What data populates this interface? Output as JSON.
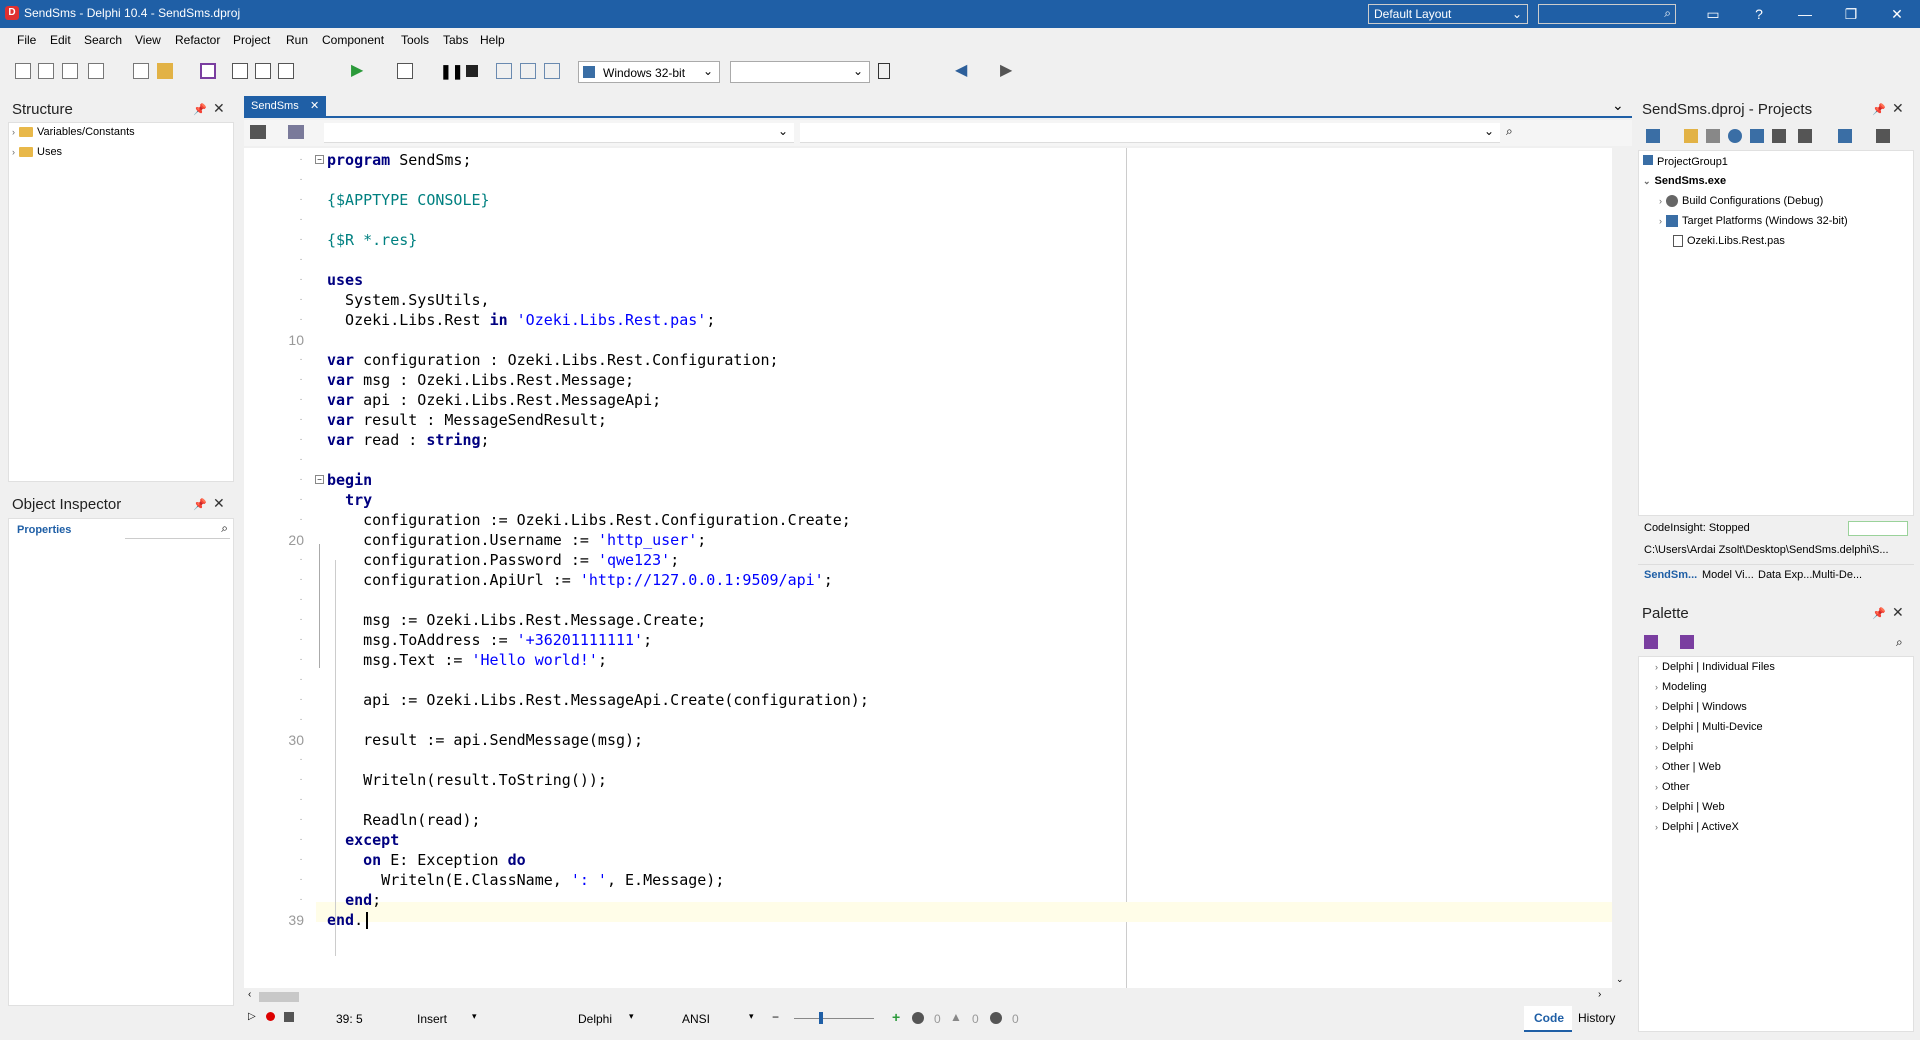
{
  "window": {
    "title": "SendSms - Delphi 10.4 - SendSms.dproj",
    "layout": "Default Layout",
    "search_placeholder": ""
  },
  "menu": [
    "File",
    "Edit",
    "Search",
    "View",
    "Refactor",
    "Project",
    "Run",
    "Component",
    "Tools",
    "Tabs",
    "Help"
  ],
  "toolbar": {
    "platform": "Windows 32-bit",
    "config": ""
  },
  "structure": {
    "title": "Structure",
    "items": [
      "Variables/Constants",
      "Uses"
    ]
  },
  "inspector": {
    "title": "Object Inspector",
    "tab": "Properties"
  },
  "editor": {
    "tab": "SendSms",
    "status": {
      "pos": "39:  5",
      "mode": "Insert",
      "lang": "Delphi",
      "enc": "ANSI",
      "code": "Code",
      "history": "History"
    }
  },
  "code": [
    [
      [
        "kw",
        "program"
      ],
      [
        "id",
        " SendSms;"
      ]
    ],
    [],
    [
      [
        "dir",
        "{$APPTYPE CONSOLE}"
      ]
    ],
    [],
    [
      [
        "dir",
        "{$R *.res}"
      ]
    ],
    [],
    [
      [
        "kw",
        "uses"
      ]
    ],
    [
      [
        "id",
        "  System.SysUtils,"
      ]
    ],
    [
      [
        "id",
        "  Ozeki.Libs.Rest "
      ],
      [
        "kw",
        "in"
      ],
      [
        "id",
        " "
      ],
      [
        "str",
        "'Ozeki.Libs.Rest.pas'"
      ],
      [
        "id",
        ";"
      ]
    ],
    [],
    [
      [
        "kw",
        "var"
      ],
      [
        "id",
        " configuration : Ozeki.Libs.Rest.Configuration;"
      ]
    ],
    [
      [
        "kw",
        "var"
      ],
      [
        "id",
        " msg : Ozeki.Libs.Rest.Message;"
      ]
    ],
    [
      [
        "kw",
        "var"
      ],
      [
        "id",
        " api : Ozeki.Libs.Rest.MessageApi;"
      ]
    ],
    [
      [
        "kw",
        "var"
      ],
      [
        "id",
        " result : MessageSendResult;"
      ]
    ],
    [
      [
        "kw",
        "var"
      ],
      [
        "id",
        " read : "
      ],
      [
        "kw",
        "string"
      ],
      [
        "id",
        ";"
      ]
    ],
    [],
    [
      [
        "kw",
        "begin"
      ]
    ],
    [
      [
        "id",
        "  "
      ],
      [
        "kw",
        "try"
      ]
    ],
    [
      [
        "id",
        "    configuration := Ozeki.Libs.Rest.Configuration.Create;"
      ]
    ],
    [
      [
        "id",
        "    configuration.Username := "
      ],
      [
        "str",
        "'http_user'"
      ],
      [
        "id",
        ";"
      ]
    ],
    [
      [
        "id",
        "    configuration.Password := "
      ],
      [
        "str",
        "'qwe123'"
      ],
      [
        "id",
        ";"
      ]
    ],
    [
      [
        "id",
        "    configuration.ApiUrl := "
      ],
      [
        "str",
        "'http://127.0.0.1:9509/api'"
      ],
      [
        "id",
        ";"
      ]
    ],
    [],
    [
      [
        "id",
        "    msg := Ozeki.Libs.Rest.Message.Create;"
      ]
    ],
    [
      [
        "id",
        "    msg.ToAddress := "
      ],
      [
        "str",
        "'+36201111111'"
      ],
      [
        "id",
        ";"
      ]
    ],
    [
      [
        "id",
        "    msg.Text := "
      ],
      [
        "str",
        "'Hello world!'"
      ],
      [
        "id",
        ";"
      ]
    ],
    [],
    [
      [
        "id",
        "    api := Ozeki.Libs.Rest.MessageApi.Create(configuration);"
      ]
    ],
    [],
    [
      [
        "id",
        "    result := api.SendMessage(msg);"
      ]
    ],
    [],
    [
      [
        "id",
        "    Writeln(result.ToString());"
      ]
    ],
    [],
    [
      [
        "id",
        "    Readln(read);"
      ]
    ],
    [
      [
        "id",
        "  "
      ],
      [
        "kw",
        "except"
      ]
    ],
    [
      [
        "id",
        "    "
      ],
      [
        "kw",
        "on"
      ],
      [
        "id",
        " E: Exception "
      ],
      [
        "kw",
        "do"
      ]
    ],
    [
      [
        "id",
        "      Writeln(E.ClassName, "
      ],
      [
        "str",
        "': '"
      ],
      [
        "id",
        ", E.Message);"
      ]
    ],
    [
      [
        "id",
        "  "
      ],
      [
        "kw",
        "end"
      ],
      [
        "id",
        ";"
      ]
    ],
    [
      [
        "kw",
        "end"
      ],
      [
        "id",
        "."
      ]
    ]
  ],
  "gutter_numbers": {
    "10": "10",
    "20": "20",
    "30": "30",
    "39": "39"
  },
  "projects": {
    "title": "SendSms.dproj - Projects",
    "items": [
      "ProjectGroup1",
      "SendSms.exe",
      "Build Configurations (Debug)",
      "Target Platforms (Windows 32-bit)",
      "Ozeki.Libs.Rest.pas"
    ],
    "codeinsight": "CodeInsight: Stopped",
    "path": "C:\\Users\\Ardai Zsolt\\Desktop\\SendSms.delphi\\S...",
    "tabs": [
      "SendSm...",
      "Model Vi...",
      "Data Exp...",
      "Multi-De..."
    ]
  },
  "palette": {
    "title": "Palette",
    "items": [
      "Delphi | Individual Files",
      "Modeling",
      "Delphi | Windows",
      "Delphi | Multi-Device",
      "Delphi",
      "Other | Web",
      "Other",
      "Delphi | Web",
      "Delphi | ActiveX"
    ]
  },
  "status_counts": [
    "0",
    "0",
    "0"
  ]
}
